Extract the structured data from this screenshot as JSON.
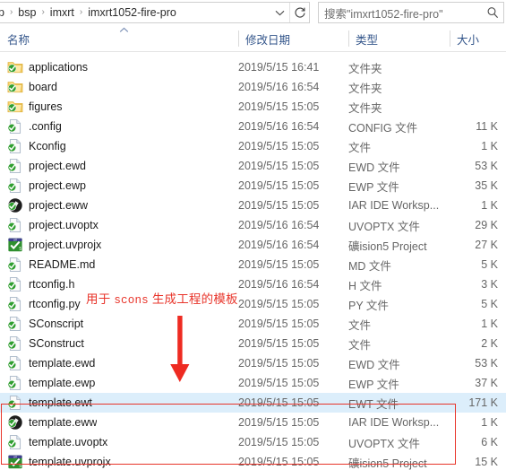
{
  "window": {
    "address": {
      "crumbs": [
        "p",
        "bsp",
        "imxrt",
        "imxrt1052-fire-pro"
      ],
      "separator": "›",
      "dropdown_icon": "chevron-down-icon",
      "refresh_icon": "refresh-icon",
      "refresh_glyph": "↻"
    },
    "search": {
      "value": "搜索\"imxrt1052-fire-pro\"",
      "placeholder": "搜索\"imxrt1052-fire-pro\"",
      "icon": "search-icon"
    }
  },
  "columns": {
    "name": "名称",
    "date_modified": "修改日期",
    "type": "类型",
    "size": "大小",
    "sort_caret": "⌃",
    "sort_column": "名称",
    "sort_direction": "ascending"
  },
  "files": [
    {
      "name": "applications",
      "date": "2019/5/15 16:41",
      "type": "文件夹",
      "size": "",
      "icon": "folder-icon",
      "selected": false
    },
    {
      "name": "board",
      "date": "2019/5/16 16:54",
      "type": "文件夹",
      "size": "",
      "icon": "folder-icon",
      "selected": false
    },
    {
      "name": "figures",
      "date": "2019/5/15 15:05",
      "type": "文件夹",
      "size": "",
      "icon": "folder-icon",
      "selected": false
    },
    {
      "name": ".config",
      "date": "2019/5/16 16:54",
      "type": "CONFIG 文件",
      "size": "11 K",
      "icon": "file-icon",
      "selected": false
    },
    {
      "name": "Kconfig",
      "date": "2019/5/15 15:05",
      "type": "文件",
      "size": "1 K",
      "icon": "file-icon",
      "selected": false
    },
    {
      "name": "project.ewd",
      "date": "2019/5/15 15:05",
      "type": "EWD 文件",
      "size": "53 K",
      "icon": "file-icon",
      "selected": false
    },
    {
      "name": "project.ewp",
      "date": "2019/5/15 15:05",
      "type": "EWP 文件",
      "size": "35 K",
      "icon": "file-icon",
      "selected": false
    },
    {
      "name": "project.eww",
      "date": "2019/5/15 15:05",
      "type": "IAR IDE Worksp...",
      "size": "1 K",
      "icon": "iar-workspace-icon",
      "selected": false
    },
    {
      "name": "project.uvoptx",
      "date": "2019/5/16 16:54",
      "type": "UVOPTX 文件",
      "size": "29 K",
      "icon": "file-icon",
      "selected": false
    },
    {
      "name": "project.uvprojx",
      "date": "2019/5/16 16:54",
      "type": "礦ision5 Project",
      "size": "27 K",
      "icon": "uvision-icon",
      "selected": false
    },
    {
      "name": "README.md",
      "date": "2019/5/15 15:05",
      "type": "MD 文件",
      "size": "5 K",
      "icon": "file-icon",
      "selected": false
    },
    {
      "name": "rtconfig.h",
      "date": "2019/5/16 16:54",
      "type": "H 文件",
      "size": "3 K",
      "icon": "file-icon",
      "selected": false
    },
    {
      "name": "rtconfig.py",
      "date": "2019/5/15 15:05",
      "type": "PY 文件",
      "size": "5 K",
      "icon": "file-icon",
      "selected": false
    },
    {
      "name": "SConscript",
      "date": "2019/5/15 15:05",
      "type": "文件",
      "size": "1 K",
      "icon": "file-icon",
      "selected": false
    },
    {
      "name": "SConstruct",
      "date": "2019/5/15 15:05",
      "type": "文件",
      "size": "2 K",
      "icon": "file-icon",
      "selected": false
    },
    {
      "name": "template.ewd",
      "date": "2019/5/15 15:05",
      "type": "EWD 文件",
      "size": "53 K",
      "icon": "file-icon",
      "selected": false
    },
    {
      "name": "template.ewp",
      "date": "2019/5/15 15:05",
      "type": "EWP 文件",
      "size": "37 K",
      "icon": "file-icon",
      "selected": false
    },
    {
      "name": "template.ewt",
      "date": "2019/5/15 15:05",
      "type": "EWT 文件",
      "size": "171 K",
      "icon": "file-icon",
      "selected": true
    },
    {
      "name": "template.eww",
      "date": "2019/5/15 15:05",
      "type": "IAR IDE Worksp...",
      "size": "1 K",
      "icon": "iar-workspace-icon",
      "selected": false
    },
    {
      "name": "template.uvoptx",
      "date": "2019/5/15 15:05",
      "type": "UVOPTX 文件",
      "size": "6 K",
      "icon": "file-icon",
      "selected": false
    },
    {
      "name": "template.uvprojx",
      "date": "2019/5/15 15:05",
      "type": "礦ision5 Project",
      "size": "15 K",
      "icon": "uvision-icon",
      "selected": false
    }
  ],
  "annotations": {
    "note_prefix": "用于 ",
    "note_mono": "scons",
    "note_suffix": " 生成工程的模板",
    "arrow": "down-arrow-annotation",
    "rect": "highlight-rectangle-annotation",
    "color": "#e8342a"
  },
  "theme": {
    "selection_bg": "#dceefb",
    "header_text": "#34568b",
    "folder_yellow": "#fcd675",
    "check_green": "#2f9e2f"
  }
}
